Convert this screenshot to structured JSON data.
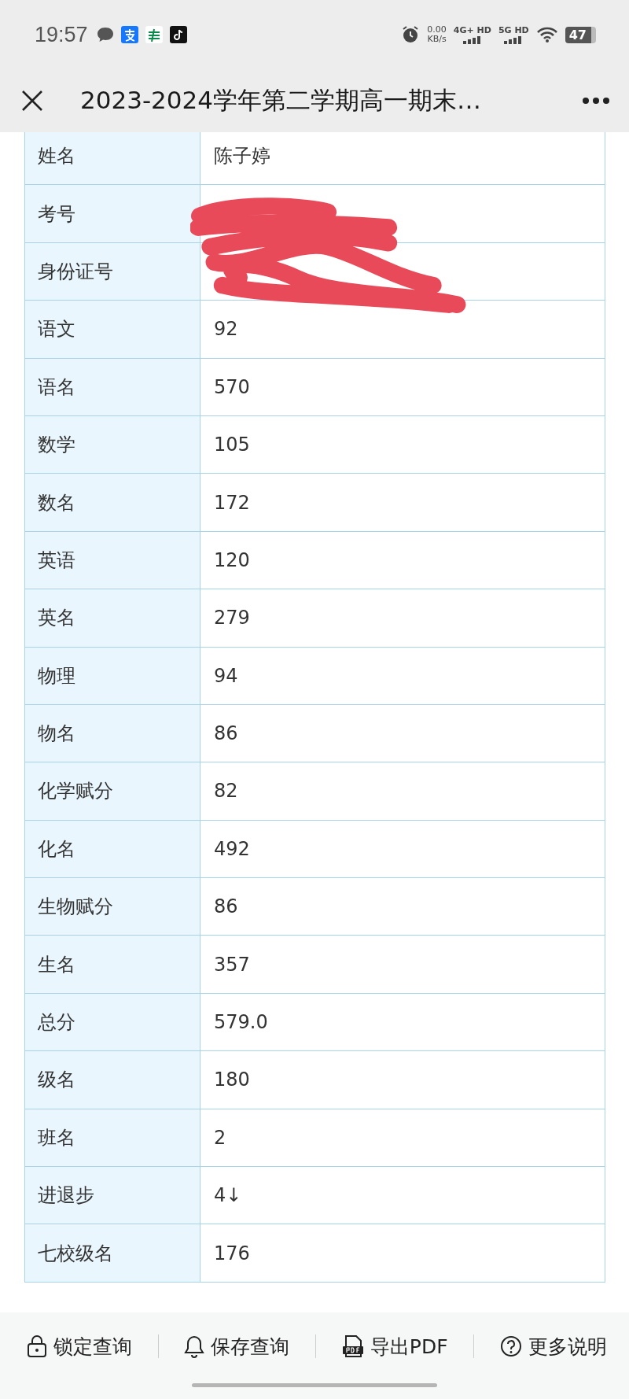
{
  "status_bar": {
    "time": "19:57",
    "speed": "0.00",
    "speed_unit": "KB/s",
    "network_1": "4G+ HD",
    "network_2": "5G HD",
    "battery": "47"
  },
  "title_bar": {
    "title": "2023-2024学年第二学期高一期末…"
  },
  "table": {
    "rows": [
      {
        "label": "姓名",
        "value": "陈子婷",
        "redacted": false
      },
      {
        "label": "考号",
        "redacted": true
      },
      {
        "label": "身份证号",
        "redacted": true
      },
      {
        "label": "语文",
        "value": "92",
        "redacted": false
      },
      {
        "label": "语名",
        "value": "570",
        "redacted": false
      },
      {
        "label": "数学",
        "value": "105",
        "redacted": false
      },
      {
        "label": "数名",
        "value": "172",
        "redacted": false
      },
      {
        "label": "英语",
        "value": "120",
        "redacted": false
      },
      {
        "label": "英名",
        "value": "279",
        "redacted": false
      },
      {
        "label": "物理",
        "value": "94",
        "redacted": false
      },
      {
        "label": "物名",
        "value": "86",
        "redacted": false
      },
      {
        "label": "化学赋分",
        "value": "82",
        "redacted": false
      },
      {
        "label": "化名",
        "value": "492",
        "redacted": false
      },
      {
        "label": "生物赋分",
        "value": "86",
        "redacted": false
      },
      {
        "label": "生名",
        "value": "357",
        "redacted": false
      },
      {
        "label": "总分",
        "value": "579.0",
        "redacted": false
      },
      {
        "label": "级名",
        "value": "180",
        "redacted": false
      },
      {
        "label": "班名",
        "value": "2",
        "redacted": false
      },
      {
        "label": "进退步",
        "value": "4↓",
        "redacted": false
      },
      {
        "label": "七校级名",
        "value": "176",
        "redacted": false
      }
    ]
  },
  "toolbar": [
    {
      "kind": "lock",
      "label": "锁定查询"
    },
    {
      "kind": "bell",
      "label": "保存查询"
    },
    {
      "kind": "pdf",
      "label": "导出PDF"
    },
    {
      "kind": "help",
      "label": "更多说明"
    }
  ]
}
